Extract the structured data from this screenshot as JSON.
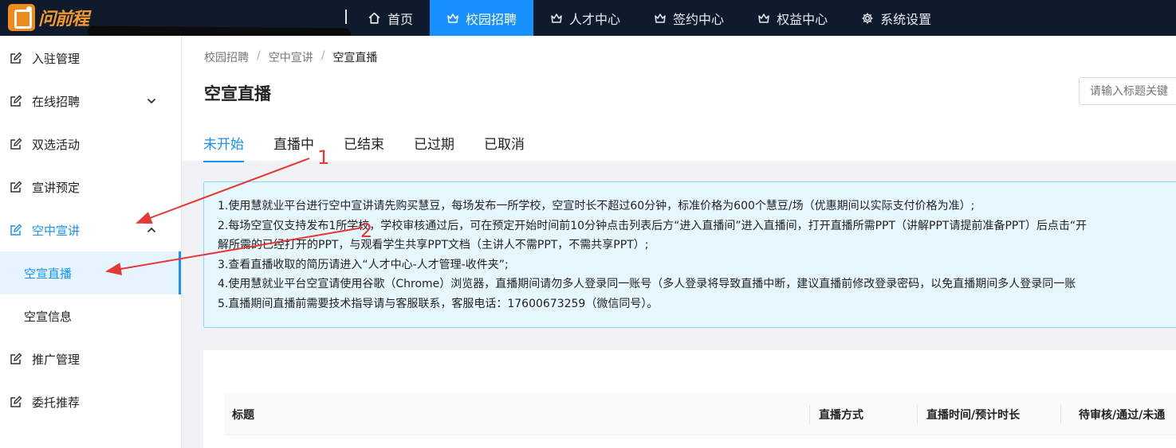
{
  "app": {
    "logo_text": "问前程"
  },
  "nav": {
    "separator": "|",
    "items": [
      {
        "label": "首页",
        "icon": "home-icon"
      },
      {
        "label": "校园招聘",
        "icon": "crown-icon",
        "active": true
      },
      {
        "label": "人才中心",
        "icon": "crown-icon"
      },
      {
        "label": "签约中心",
        "icon": "crown-icon"
      },
      {
        "label": "权益中心",
        "icon": "crown-icon"
      },
      {
        "label": "系统设置",
        "icon": "gear-icon"
      }
    ]
  },
  "sidebar": {
    "items": [
      {
        "label": "入驻管理"
      },
      {
        "label": "在线招聘"
      },
      {
        "label": "双选活动"
      },
      {
        "label": "宣讲预定"
      },
      {
        "label": "空中宣讲"
      },
      {
        "label": "空宣直播"
      },
      {
        "label": "空宣信息"
      },
      {
        "label": "推广管理"
      },
      {
        "label": "委托推荐"
      }
    ]
  },
  "breadcrumb": {
    "items": [
      "校园招聘",
      "空中宣讲",
      "空宣直播"
    ],
    "separator": "/"
  },
  "page": {
    "title": "空宣直播"
  },
  "search": {
    "placeholder": "请输入标题关键"
  },
  "tabs": [
    "未开始",
    "直播中",
    "已结束",
    "已过期",
    "已取消"
  ],
  "notice": {
    "lines": [
      "1.使用慧就业平台进行空中宣讲请先购买慧豆，每场发布一所学校，空宣时长不超过60分钟，标准价格为600个慧豆/场（优惠期间以实际支付价格为准）;",
      "2.每场空宣仅支持发布1所学校，学校审核通过后，可在预定开始时间前10分钟点击列表后方“进入直播间”进入直播间，打开直播所需PPT（讲解PPT请提前准备PPT）后点击“开",
      "解所需的已经打开的PPT，与观看学生共享PPT文档（主讲人不需PPT，不需共享PPT）;",
      "3.查看直播收取的简历请进入“人才中心-人才管理-收件夹”;",
      "4.使用慧就业平台空宣请使用谷歌（Chrome）浏览器，直播期间请勿多人登录同一账号（多人登录将导致直播中断，建议直播前修改登录密码，以免直播期间多人登录同一账",
      "5.直播期间直播前需要技术指导请与客服联系，客服电话：17600673259（微信同号）。"
    ]
  },
  "table": {
    "headers": [
      "标题",
      "直播方式",
      "直播时间/预计时长",
      "待审核/通过/未通"
    ]
  },
  "annotations": {
    "arrow1_label": "1",
    "arrow2_label": "2",
    "color": "#e53935"
  },
  "colors": {
    "accent": "#1890ff",
    "topbar": "#0f1a2c",
    "notice_bg": "#e6f7ff"
  }
}
